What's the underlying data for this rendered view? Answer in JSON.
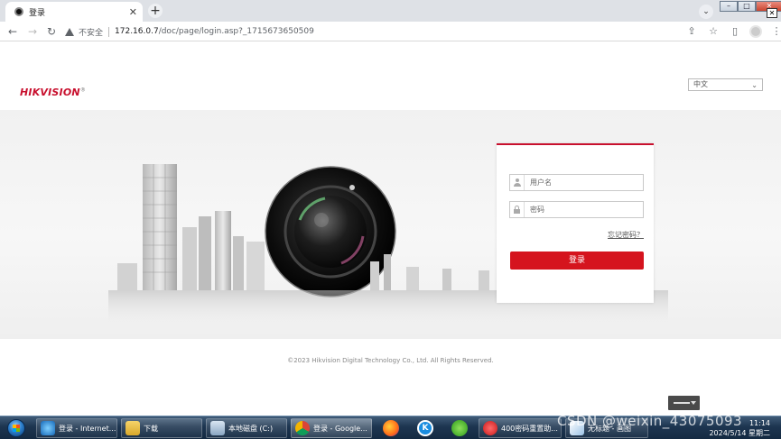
{
  "browser": {
    "tab_title": "登录",
    "close_glyph": "✕",
    "new_tab_glyph": "+",
    "insecure_label": "不安全",
    "url_host": "172.16.0.7",
    "url_path": "/doc/page/login.asp?_1715673650509"
  },
  "page": {
    "logo_text": "HIKVISION",
    "logo_reg": "®",
    "language_selected": "中文",
    "username_placeholder": "用户名",
    "password_placeholder": "密码",
    "forgot_password": "忘记密码？",
    "login_button": "登录",
    "copyright": "©2023 Hikvision Digital Technology Co., Ltd. All Rights Reserved.",
    "accent_color": "#d5141e"
  },
  "taskbar": {
    "items": [
      {
        "label": "登录 - Internet...",
        "icon": "ie-icon"
      },
      {
        "label": "下载",
        "icon": "folder-icon"
      },
      {
        "label": "本地磁盘 (C:)",
        "icon": "drive-icon"
      },
      {
        "label": "登录 - Google...",
        "icon": "chrome-icon"
      },
      {
        "label": "400密码重置助...",
        "icon": "app-icon"
      },
      {
        "label": "无标题 - 画图",
        "icon": "paint-icon"
      }
    ],
    "time": "11:14",
    "date": "2024/5/14 星期二"
  },
  "watermark": "CSDN @weixin_43075093"
}
